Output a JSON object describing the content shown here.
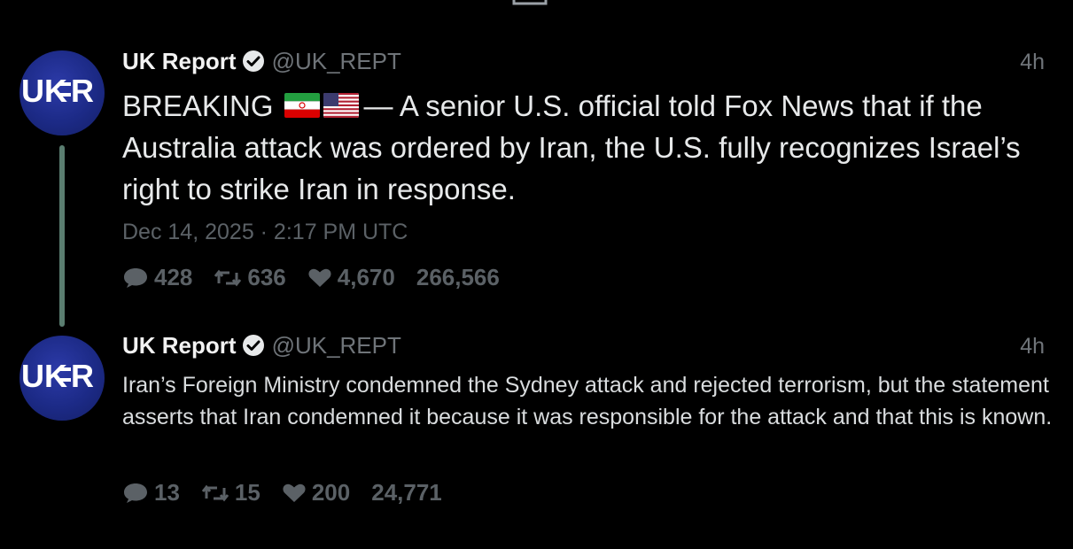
{
  "tweets": [
    {
      "author_name": "UK Report",
      "handle": "@UK_REPT",
      "time": "4h",
      "text_before_flags": "BREAKING",
      "flags": [
        "iran-flag",
        "us-flag"
      ],
      "text_after_flags": "— A senior U.S. official told Fox News that if the Australia attack was ordered by Iran, the U.S. fully recognizes Israel’s right to strike Iran in response.",
      "date": "Dec 14, 2025 · 2:17 PM UTC",
      "replies": "428",
      "retweets": "636",
      "likes": "4,670",
      "views": "266,566"
    },
    {
      "author_name": "UK Report",
      "handle": "@UK_REPT",
      "time": "4h",
      "text": "Iran’s Foreign Ministry condemned the Sydney attack and rejected terrorism, but the statement asserts that Iran condemned it because it was responsible for the attack and that this is known.",
      "replies": "13",
      "retweets": "15",
      "likes": "200",
      "views": "24,771"
    }
  ],
  "avatar_text": "UKR",
  "icons": [
    "reply-icon",
    "retweet-icon",
    "like-icon",
    "verified-icon"
  ],
  "colors": {
    "background": "#000000",
    "thread_line": "#5a7d70",
    "avatar": "#1c2a86",
    "muted": "#6f7479"
  }
}
